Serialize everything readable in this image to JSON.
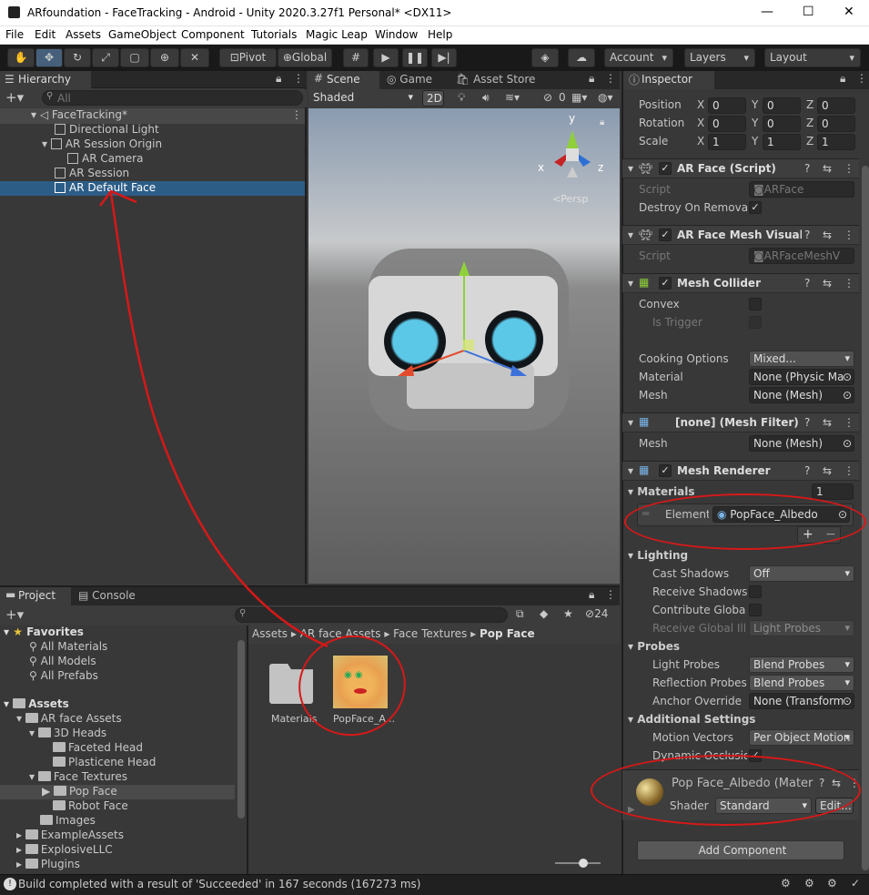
{
  "window": {
    "title": "ARfoundation - FaceTracking - Android - Unity 2020.3.27f1 Personal* <DX11>"
  },
  "menu": [
    "File",
    "Edit",
    "Assets",
    "GameObject",
    "Component",
    "Tutorials",
    "Magic Leap",
    "Window",
    "Help"
  ],
  "toolbar": {
    "pivot": "Pivot",
    "global": "Global",
    "account": "Account",
    "layers": "Layers",
    "layout": "Layout"
  },
  "hierarchy": {
    "tab": "Hierarchy",
    "search_placeholder": "All",
    "scene": "FaceTracking*",
    "items": [
      "Directional Light",
      "AR Session Origin",
      "AR Camera",
      "AR Session",
      "AR Default Face"
    ]
  },
  "scene_view": {
    "tabs": [
      "Scene",
      "Game",
      "Asset Store"
    ],
    "shading": "Shaded",
    "mode2d": "2D",
    "gizmo_count": "0",
    "persp": "Persp",
    "axis": {
      "x": "x",
      "y": "y",
      "z": "z"
    }
  },
  "inspector": {
    "tab": "Inspector",
    "transform": {
      "position_label": "Position",
      "rotation_label": "Rotation",
      "scale_label": "Scale",
      "axis": [
        "X",
        "Y",
        "Z"
      ],
      "position": [
        "0",
        "0",
        "0"
      ],
      "rotation": [
        "0",
        "0",
        "0"
      ],
      "scale": [
        "1",
        "1",
        "1"
      ]
    },
    "ar_face": {
      "title": "AR Face (Script)",
      "script_label": "Script",
      "script": "ARFace",
      "destroy_label": "Destroy On Removal"
    },
    "ar_face_mesh": {
      "title": "AR Face Mesh Visualize",
      "script_label": "Script",
      "script": "ARFaceMeshV"
    },
    "mesh_collider": {
      "title": "Mesh Collider",
      "convex": "Convex",
      "is_trigger": "Is Trigger",
      "cooking_label": "Cooking Options",
      "cooking": "Mixed...",
      "material_label": "Material",
      "material": "None (Physic Ma",
      "mesh_label": "Mesh",
      "mesh": "None (Mesh)"
    },
    "mesh_filter": {
      "title": "[none] (Mesh Filter)",
      "mesh_label": "Mesh",
      "mesh": "None (Mesh)"
    },
    "mesh_renderer": {
      "title": "Mesh Renderer",
      "materials_label": "Materials",
      "materials_count": "1",
      "element_label": "Element (",
      "element_value": "PopFace_Albedo",
      "plus": "+",
      "minus": "−",
      "lighting": "Lighting",
      "cast_shadows_label": "Cast Shadows",
      "cast_shadows": "Off",
      "receive_shadows_label": "Receive Shadows",
      "contribute_gi_label": "Contribute Global I",
      "receive_gi_label": "Receive Global Illu",
      "receive_gi": "Light Probes",
      "probes": "Probes",
      "light_probes_label": "Light Probes",
      "light_probes": "Blend Probes",
      "reflection_probes_label": "Reflection Probes",
      "reflection_probes": "Blend Probes",
      "anchor_override_label": "Anchor Override",
      "anchor_override": "None (Transform",
      "additional": "Additional Settings",
      "motion_vectors_label": "Motion Vectors",
      "motion_vectors": "Per Object Motion",
      "dynamic_occlusion_label": "Dynamic Occlusion"
    },
    "material": {
      "title": "Pop Face_Albedo (Mater",
      "shader_label": "Shader",
      "shader": "Standard",
      "edit": "Edit..."
    },
    "add_component": "Add Component"
  },
  "project": {
    "tabs": [
      "Project",
      "Console"
    ],
    "hidden_count": "24",
    "favorites": "Favorites",
    "favorite_items": [
      "All Materials",
      "All Models",
      "All Prefabs"
    ],
    "assets": "Assets",
    "tree": [
      "AR face Assets",
      "3D Heads",
      "Faceted Head",
      "Plasticene Head",
      "Face Textures",
      "Pop Face",
      "Robot Face",
      "Images",
      "ExampleAssets",
      "ExplosiveLLC",
      "Plugins"
    ],
    "breadcrumb": [
      "Assets",
      "AR face Assets",
      "Face Textures",
      "Pop Face"
    ],
    "files": [
      "Materials",
      "PopFace_A..."
    ]
  },
  "status": {
    "message": "Build completed with a result of 'Succeeded' in 167 seconds (167273 ms)"
  },
  "colors": {
    "selection": "#2c5d87",
    "annotation": "#d71818",
    "accent": "#46607c"
  }
}
